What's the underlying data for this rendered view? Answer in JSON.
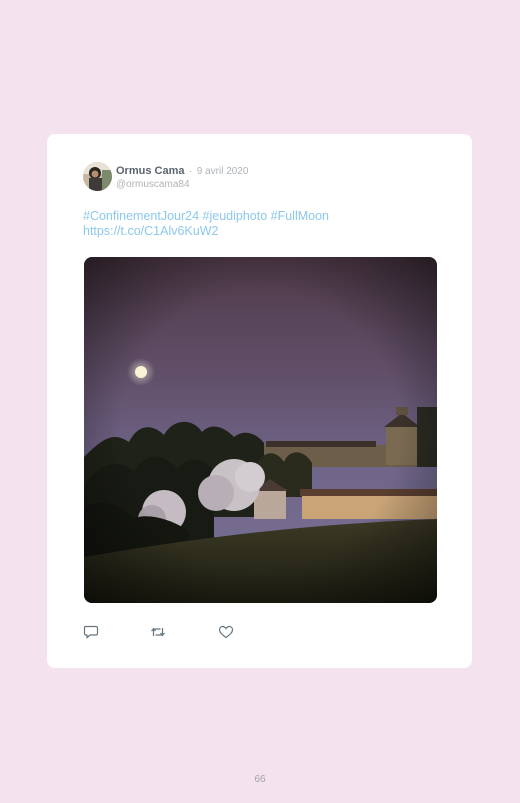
{
  "tweet": {
    "author_name": "Ormus Cama",
    "separator": "·",
    "date": "9 avril 2020",
    "handle": "@ormuscama84",
    "text_line1": "#ConfinementJour24 #jeudiphoto #FullMoon",
    "text_line2": "https://t.co/C1Alv6KuW2"
  },
  "actions": {
    "reply_icon": "comment-icon",
    "retweet_icon": "retweet-icon",
    "like_icon": "heart-icon"
  },
  "page": {
    "number": "66"
  },
  "colors": {
    "page_background": "#f4e2ee",
    "card_background": "#ffffff",
    "link_blue": "#8bc8ee",
    "muted_gray": "#aeb4ba",
    "name_gray": "#5b6470"
  }
}
